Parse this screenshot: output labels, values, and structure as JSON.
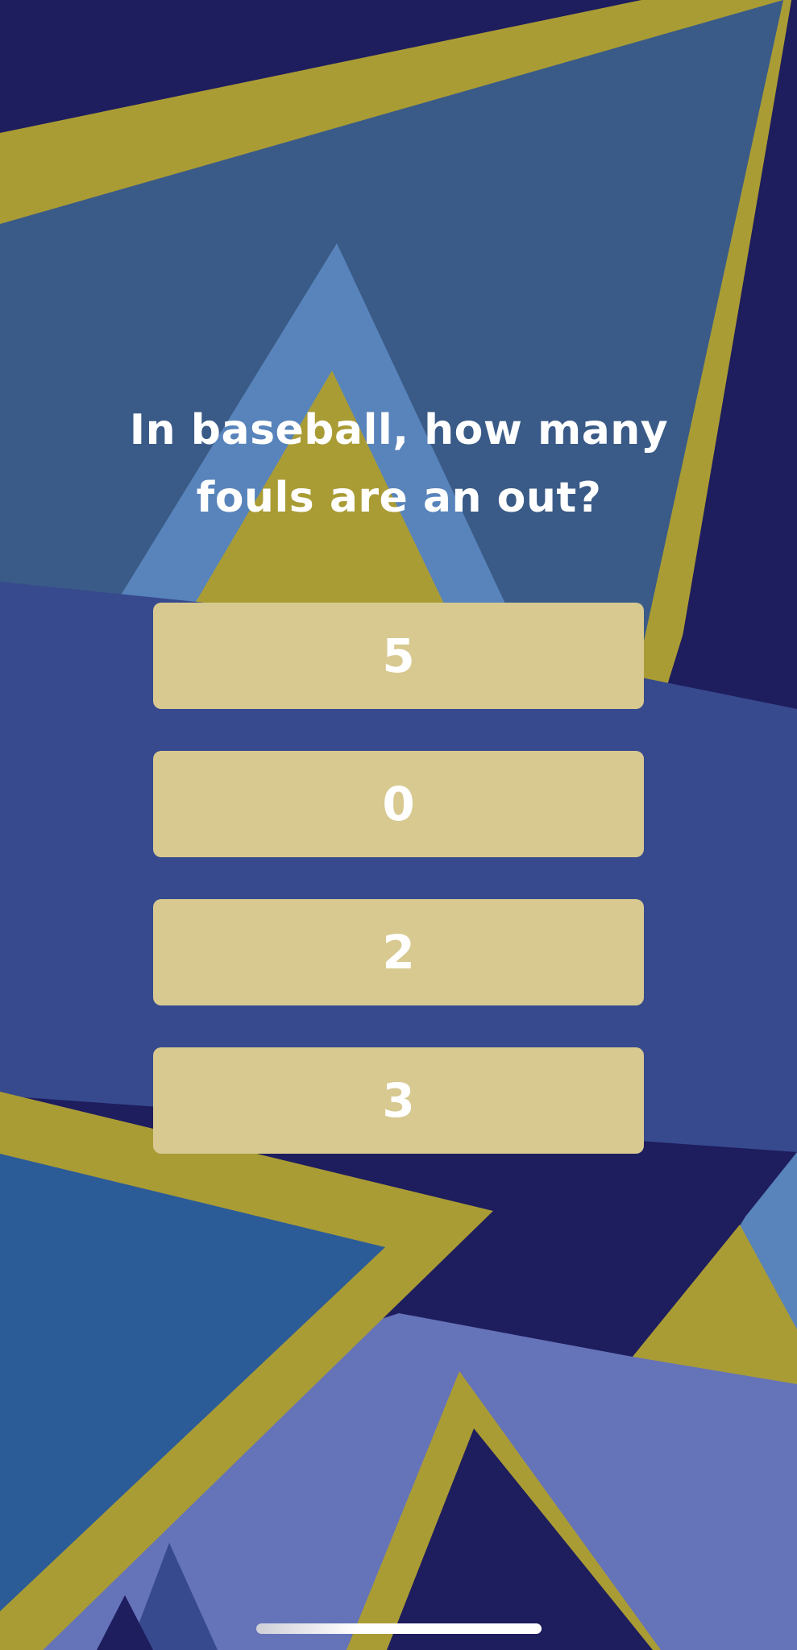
{
  "quiz": {
    "question": "In baseball, how many fouls are an out?",
    "answers": [
      "5",
      "0",
      "2",
      "3"
    ]
  },
  "theme": {
    "background_navy": "#1e1d5e",
    "gold": "#aa9c35",
    "steel_blue": "#3a5b87",
    "light_blue": "#5884bb",
    "royal_blue": "#374a8e",
    "periwinkle": "#6573b8",
    "answer_button": "#d7c990",
    "text": "#ffffff"
  }
}
